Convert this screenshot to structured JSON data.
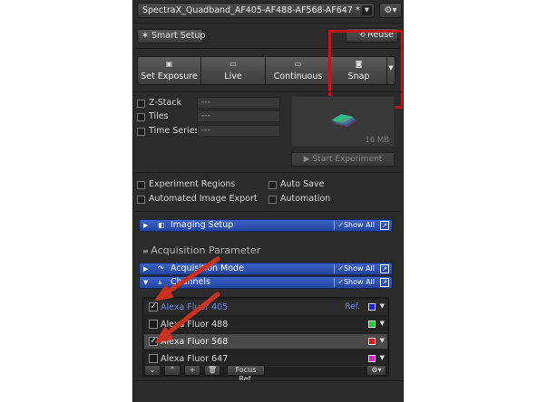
{
  "experiment": {
    "name": "SpectraX_Quadband_AF405-AF488-AF568-AF647 *",
    "dropdown_icon": "chevron-down-icon",
    "options_icon": "gear-icon"
  },
  "smart_setup": {
    "label": "Smart Setup",
    "icon": "wand-icon"
  },
  "reuse": {
    "label": "Reuse",
    "icon": "reuse-icon"
  },
  "acquire_buttons": [
    {
      "label": "Set Exposure",
      "icon": "camera-icon"
    },
    {
      "label": "Live",
      "icon": "live-icon"
    },
    {
      "label": "Continuous",
      "icon": "continuous-icon"
    },
    {
      "label": "Snap",
      "icon": "snap-camera-icon"
    }
  ],
  "dimensions": [
    {
      "label": "Z-Stack",
      "value": "---"
    },
    {
      "label": "Tiles",
      "value": "---"
    },
    {
      "label": "Time Series",
      "value": "---"
    }
  ],
  "preview": {
    "size_label": "16 MB"
  },
  "start_experiment": {
    "label": "Start Experiment"
  },
  "options": {
    "experiment_regions": "Experiment Regions",
    "auto_save": "Auto Save",
    "automated_image_export": "Automated Image Export",
    "automation": "Automation"
  },
  "tools": {
    "imaging_setup": {
      "title": "Imaging Setup",
      "show_all": "Show All"
    },
    "acquisition_parameter": "Acquisition Parameter",
    "acquisition_mode": {
      "title": "Acquisition Mode",
      "show_all": "Show All"
    },
    "channels": {
      "title": "Channels",
      "show_all": "Show All"
    }
  },
  "channels": [
    {
      "name": "Alexa Fluor 405",
      "checked": true,
      "ref": "Ref.",
      "color": "#1a1adc",
      "selected": false
    },
    {
      "name": "Alexa Fluor 488",
      "checked": false,
      "ref": "",
      "color": "#12d43a",
      "selected": false
    },
    {
      "name": "Alexa Fluor 568",
      "checked": true,
      "ref": "",
      "color": "#e01414",
      "selected": true
    },
    {
      "name": "Alexa Fluor 647",
      "checked": false,
      "ref": "",
      "color": "#d41fd4",
      "selected": false
    }
  ],
  "channel_toolbar": {
    "down": "⌄",
    "up": "⌃",
    "add": "+",
    "delete_icon": "trash-icon",
    "focus_ref": "Focus Ref.",
    "settings_icon": "gear-icon"
  },
  "accent_colors": {
    "panel_bg": "#2b2b2b",
    "bar_blue": "#2e54b8",
    "channel_blue_text": "#6a8ae6",
    "highlight_box": "#c0161c",
    "annotation_arrow": "#c8321e"
  }
}
